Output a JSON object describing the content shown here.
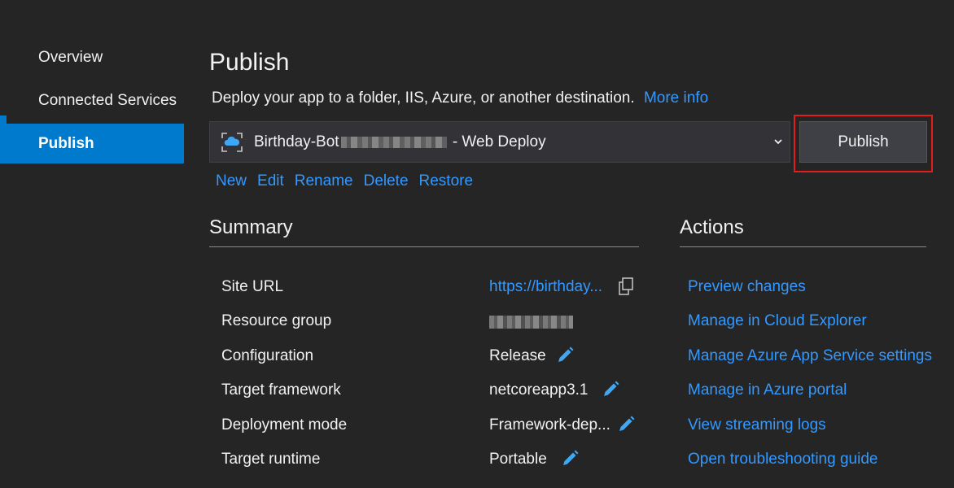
{
  "nav": {
    "items": [
      {
        "label": "Overview"
      },
      {
        "label": "Connected Services"
      },
      {
        "label": "Publish"
      }
    ]
  },
  "header": {
    "title": "Publish",
    "subtitle": "Deploy your app to a folder, IIS, Azure, or another destination.",
    "more_info": "More info"
  },
  "profile": {
    "name_prefix": "Birthday-Bot",
    "name_suffix": " - Web Deploy",
    "icon": "cloud-web-app-icon"
  },
  "publish_button": "Publish",
  "profile_actions": [
    "New",
    "Edit",
    "Rename",
    "Delete",
    "Restore"
  ],
  "summary": {
    "title": "Summary",
    "rows": [
      {
        "label": "Site URL",
        "value": "https://birthday..."
      },
      {
        "label": "Resource group",
        "value": ""
      },
      {
        "label": "Configuration",
        "value": "Release"
      },
      {
        "label": "Target framework",
        "value": "netcoreapp3.1"
      },
      {
        "label": "Deployment mode",
        "value": "Framework-dep..."
      },
      {
        "label": "Target runtime",
        "value": "Portable"
      }
    ]
  },
  "actions": {
    "title": "Actions",
    "items": [
      "Preview changes",
      "Manage in Cloud Explorer",
      "Manage Azure App Service settings",
      "Manage in Azure portal",
      "View streaming logs",
      "Open troubleshooting guide"
    ]
  },
  "colors": {
    "background": "#252526",
    "accent": "#007acc",
    "link": "#3399ff",
    "highlight": "#e51c1c"
  }
}
